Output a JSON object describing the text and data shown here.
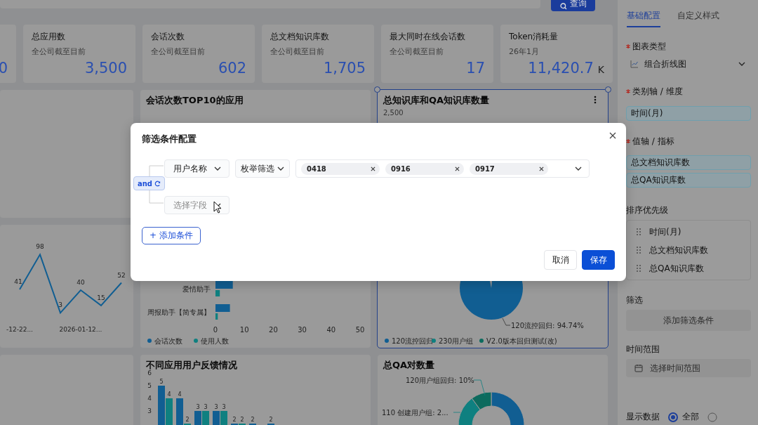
{
  "toolbar": {
    "query_button": "查询"
  },
  "stats": [
    {
      "value": "0"
    },
    {
      "title": "总应用数",
      "subtitle": "全公司截至目前",
      "value": "3,500"
    },
    {
      "title": "会话次数",
      "subtitle": "全公司截至目前",
      "value": "602"
    },
    {
      "title": "总文档知识库数",
      "subtitle": "全公司截至目前",
      "value": "1,705"
    },
    {
      "title": "最大同时在线会话数",
      "subtitle": "全公司截至目前",
      "value": "17"
    },
    {
      "title": "Token消耗量",
      "subtitle": "26年1月",
      "value": "11,420.7",
      "unit": "K"
    }
  ],
  "trend_card": {
    "chart_data": {
      "type": "line",
      "data_labels": true,
      "categories": [
        "-12-22...",
        null,
        null,
        "2026-01-12...",
        null,
        null
      ],
      "values": [
        41,
        98,
        3,
        40,
        15,
        52
      ]
    }
  },
  "top_apps_card": {
    "title": "会话次数TOP10的应用",
    "chart_data": {
      "type": "bar",
      "orientation": "horizontal",
      "legend": "bottom",
      "categories": [
        "爱情助手",
        "周报助手【简专属】"
      ],
      "xlim": [
        0,
        50
      ],
      "xticks": [
        0,
        10,
        20,
        30,
        40,
        50
      ],
      "series": [
        {
          "name": "会话次数",
          "color": "#115e92",
          "values": [
            6,
            5
          ]
        },
        {
          "name": "使用人数",
          "color": "#0f8080",
          "values": [
            1.5,
            0.8
          ]
        }
      ]
    }
  },
  "knowledge_card": {
    "title": "总知识库和QA知识库数量",
    "selected": true,
    "axis_label": "2,500",
    "slice_label": "120流控回归: 94.74%",
    "legend": [
      {
        "label": "120流控回归",
        "color": "#115e92"
      },
      {
        "label": "230用户组",
        "color": "#0f8080"
      },
      {
        "label": "V2.0版本回归测试(改)",
        "color": "#0d6b5e"
      }
    ]
  },
  "feedback_card": {
    "title": "不同应用用户反馈情况",
    "y_labels": [
      "6",
      "5",
      "4",
      "3"
    ],
    "groups": [
      {
        "bars": [
          {
            "label": "5",
            "color": "#115e92"
          },
          {
            "label": "4",
            "color": "#0f8080"
          }
        ]
      },
      {
        "bars": [
          {
            "label": "4",
            "color": "#115e92"
          },
          {
            "label": "2",
            "color": "#0f8080"
          }
        ]
      },
      {
        "bars": [
          {
            "label": "3",
            "color": "#115e92"
          },
          {
            "label": "3",
            "color": "#0f8080"
          }
        ]
      },
      {
        "bars": [
          {
            "label": "3",
            "color": "#115e92"
          },
          {
            "label": "3",
            "color": "#0f8080"
          }
        ]
      },
      {
        "bars": [
          {
            "label": "2",
            "color": "#115e92"
          },
          {
            "label": "2",
            "color": "#0f8080"
          }
        ]
      },
      {
        "bars": [
          {
            "label": "2",
            "color": "#115e92"
          }
        ]
      },
      {
        "bars": [
          {
            "label": "2",
            "color": "#115e92"
          }
        ]
      }
    ]
  },
  "qa_card": {
    "title": "总QA对数量",
    "labels": [
      "120用户组回归: 10%",
      "110 创建用户组: 2..."
    ]
  },
  "side_panel": {
    "tabs": [
      {
        "label": "基础配置",
        "selected": true
      },
      {
        "label": "自定义样式",
        "selected": false
      }
    ],
    "chart_type": {
      "label": "图表类型",
      "required": true,
      "value": "组合折线图"
    },
    "category_axis": {
      "label": "类别轴 / 维度",
      "required": true,
      "chips": [
        "时间(月)"
      ]
    },
    "value_axis": {
      "label": "值轴 / 指标",
      "required": true,
      "chips": [
        "总文档知识库数",
        "总QA知识库数"
      ]
    },
    "sort": {
      "label": "排序优先级",
      "items": [
        "时间(月)",
        "总文档知识库数",
        "总QA知识库数"
      ]
    },
    "filter": {
      "label": "筛选",
      "button": "添加筛选条件"
    },
    "time_range": {
      "label": "时间范围",
      "placeholder": "选择时间范围"
    },
    "display": {
      "label": "显示数据",
      "options": [
        {
          "label": "全部",
          "selected": true
        },
        {
          "selected": false
        }
      ]
    }
  },
  "modal": {
    "title": "筛选条件配置",
    "logic": "and",
    "conditions": [
      {
        "field": "用户名称",
        "operator": "枚举筛选",
        "values": [
          "0418",
          "0916",
          "0917"
        ]
      },
      {
        "field_placeholder": "选择字段"
      }
    ],
    "add_button": "+ 添加条件",
    "buttons": [
      {
        "label": "取消",
        "kind": "secondary"
      },
      {
        "label": "保存",
        "kind": "primary"
      }
    ]
  }
}
